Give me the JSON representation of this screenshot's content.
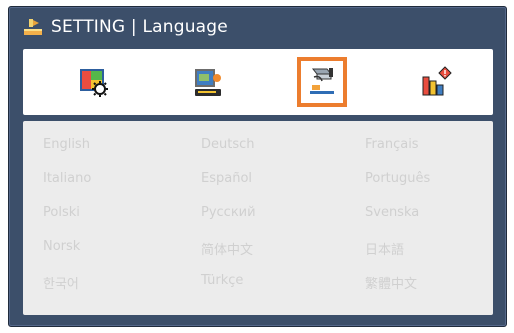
{
  "window": {
    "title": "SETTING | Language"
  },
  "tabs": [
    {
      "name": "picture",
      "icon": "picture-settings-icon",
      "active": false
    },
    {
      "name": "display",
      "icon": "display-settings-icon",
      "active": false
    },
    {
      "name": "setup",
      "icon": "setup-icon",
      "active": true
    },
    {
      "name": "options",
      "icon": "options-icon",
      "active": false
    }
  ],
  "languages": [
    [
      "English",
      "Deutsch",
      "Français"
    ],
    [
      "Italiano",
      "Español",
      "Português"
    ],
    [
      "Polski",
      "Русский",
      "Svenska"
    ],
    [
      "Norsk",
      "简体中文",
      "日本語"
    ],
    [
      "한국어",
      "Türkçe",
      "繁體中文"
    ]
  ],
  "colors": {
    "window_bg": "#3c4f6a",
    "active_tab_outline": "#ec7d2e",
    "language_text": "#d0d0d0",
    "panel_bg": "#ececec"
  }
}
